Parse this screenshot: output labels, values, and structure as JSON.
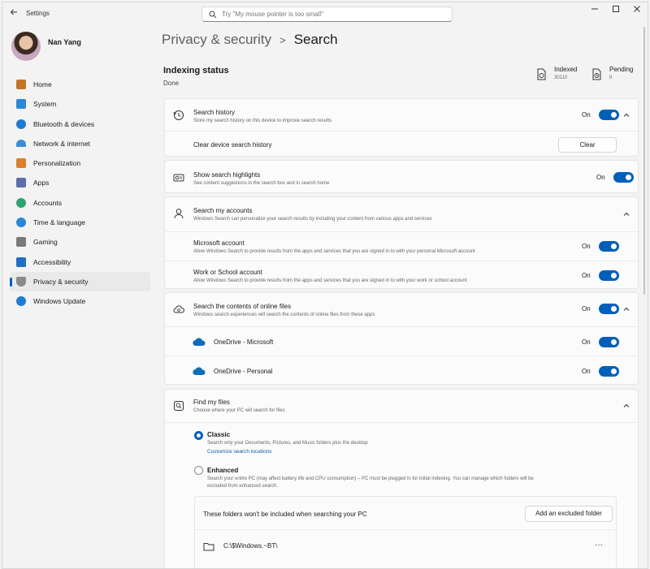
{
  "app": {
    "title": "Settings"
  },
  "search": {
    "placeholder": "Try \"My mouse pointer is too small\""
  },
  "profile": {
    "name": "Nan Yang"
  },
  "nav": [
    {
      "label": "Home",
      "icon": "home-icon",
      "color": "#c4732a"
    },
    {
      "label": "System",
      "icon": "system-icon",
      "color": "#2b88d8"
    },
    {
      "label": "Bluetooth & devices",
      "icon": "bluetooth-icon",
      "color": "#1f7bd1"
    },
    {
      "label": "Network & internet",
      "icon": "wifi-icon",
      "color": "#3b8ed6"
    },
    {
      "label": "Personalization",
      "icon": "brush-icon",
      "color": "#d9822b"
    },
    {
      "label": "Apps",
      "icon": "apps-icon",
      "color": "#5b6fa8"
    },
    {
      "label": "Accounts",
      "icon": "person-icon",
      "color": "#2fa36b"
    },
    {
      "label": "Time & language",
      "icon": "globe-clock-icon",
      "color": "#2b88d8"
    },
    {
      "label": "Gaming",
      "icon": "gamepad-icon",
      "color": "#7a7a7a"
    },
    {
      "label": "Accessibility",
      "icon": "accessibility-icon",
      "color": "#1f6fc1"
    },
    {
      "label": "Privacy & security",
      "icon": "shield-icon",
      "color": "#8a8a8a"
    },
    {
      "label": "Windows Update",
      "icon": "update-icon",
      "color": "#1f7bd1"
    }
  ],
  "nav_active_index": 10,
  "breadcrumb": {
    "parent": "Privacy & security",
    "separator": ">",
    "current": "Search"
  },
  "indexing": {
    "title": "Indexing status",
    "status": "Done",
    "indexed_label": "Indexed",
    "indexed_value": "30110",
    "pending_label": "Pending",
    "pending_value": "0"
  },
  "search_history": {
    "title": "Search history",
    "subtitle": "Store my search history on this device to improve search results",
    "toggle": "On",
    "clear_label": "Clear device search history",
    "clear_button": "Clear"
  },
  "highlights": {
    "title": "Show search highlights",
    "subtitle": "See content suggestions in the search box and in search home",
    "toggle": "On"
  },
  "accounts": {
    "title": "Search my accounts",
    "subtitle": "Windows Search can personalize your search results by including your content from various apps and services",
    "microsoft_title": "Microsoft account",
    "microsoft_sub": "Allow Windows Search to provide results from the apps and services that you are signed in to with your personal Microsoft account",
    "microsoft_toggle": "On",
    "work_title": "Work or School account",
    "work_sub": "Allow Windows Search to provide results from the apps and services that you are signed in to with your work or school account",
    "work_toggle": "On"
  },
  "online_files": {
    "title": "Search the contents of online files",
    "subtitle": "Windows search experiences will search the contents of online files from these apps",
    "toggle": "On",
    "onedrive_ms": "OneDrive - Microsoft",
    "onedrive_ms_toggle": "On",
    "onedrive_personal": "OneDrive - Personal",
    "onedrive_personal_toggle": "On"
  },
  "find_files": {
    "title": "Find my files",
    "subtitle": "Choose where your PC will search for files",
    "classic_title": "Classic",
    "classic_sub": "Search only your Documents, Pictures, and Music folders plus the desktop",
    "classic_link": "Customize search locations",
    "enhanced_title": "Enhanced",
    "enhanced_sub1": "Search your entire PC (may affect battery life and CPU consumption) – PC must be plugged in for initial indexing. You can manage which folders will be",
    "enhanced_sub2": "excluded from enhanced search.",
    "selected": "Classic",
    "excluded_label": "These folders won't be included when searching your PC",
    "excluded_button": "Add an excluded folder",
    "folder_path": "C:\\$Windows.~BT\\",
    "folder_more": "···"
  },
  "colors": {
    "accent": "#005fb8",
    "card": "#fbfbfb",
    "background": "#f3f3f3"
  }
}
